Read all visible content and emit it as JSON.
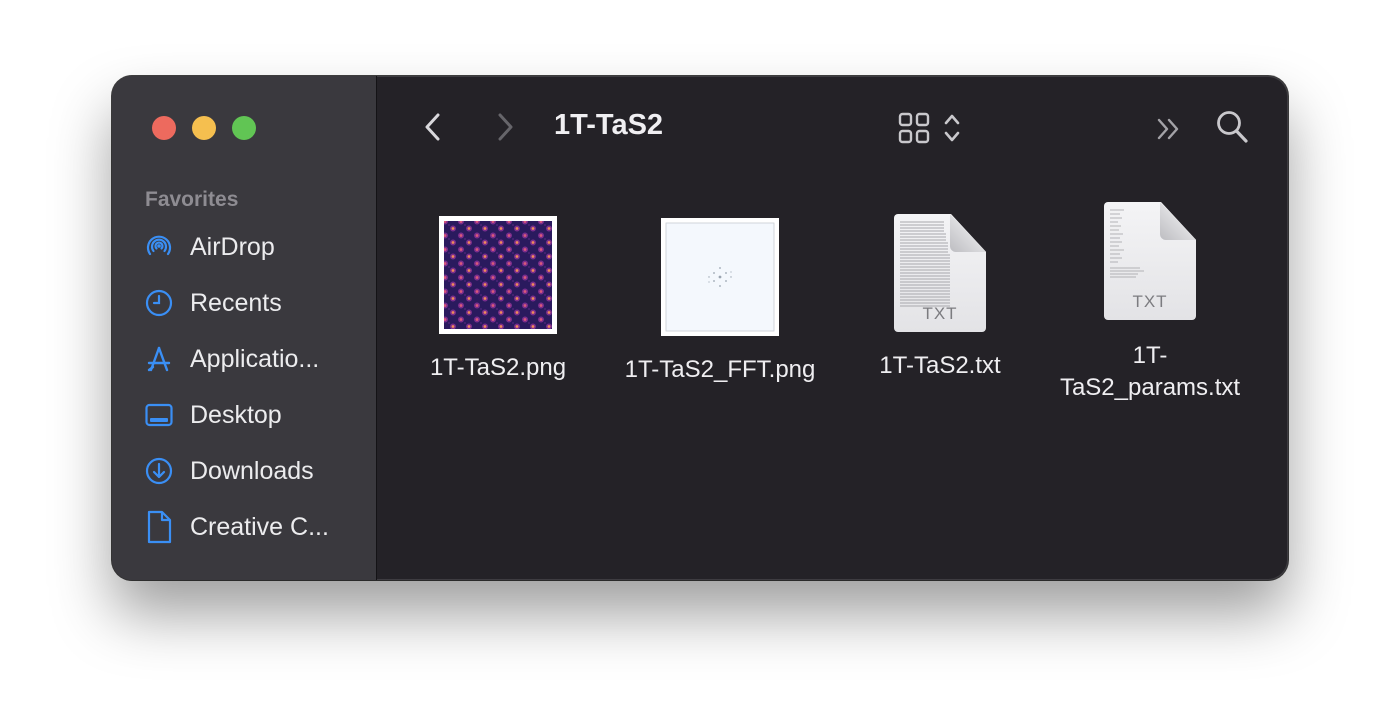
{
  "window": {
    "title": "1T-TaS2"
  },
  "sidebar": {
    "section": "Favorites",
    "items": [
      {
        "label": "AirDrop",
        "icon": "airdrop-icon"
      },
      {
        "label": "Recents",
        "icon": "clock-icon"
      },
      {
        "label": "Applicatio...",
        "icon": "applications-icon"
      },
      {
        "label": "Desktop",
        "icon": "desktop-icon"
      },
      {
        "label": "Downloads",
        "icon": "downloads-icon"
      },
      {
        "label": "Creative C...",
        "icon": "document-icon"
      }
    ]
  },
  "toolbar": {
    "back_icon": "chevron-left-icon",
    "forward_icon": "chevron-right-icon",
    "view_icon": "grid-view-icon",
    "more_icon": "chevron-double-right-icon",
    "search_icon": "search-icon"
  },
  "files": [
    {
      "name": "1T-TaS2.png",
      "kind": "image-thumbnail"
    },
    {
      "name": "1T-TaS2_FFT.png",
      "kind": "image-thumbnail"
    },
    {
      "name": "1T-TaS2.txt",
      "kind": "txt-document",
      "ext": "TXT"
    },
    {
      "name_line1": "1T-",
      "name_line2": "TaS2_params.txt",
      "kind": "txt-document",
      "ext": "TXT"
    }
  ],
  "colors": {
    "accent": "#3a8ff5",
    "close": "#ed6a5e",
    "minimize": "#f5bf4f",
    "maximize": "#61c554"
  }
}
